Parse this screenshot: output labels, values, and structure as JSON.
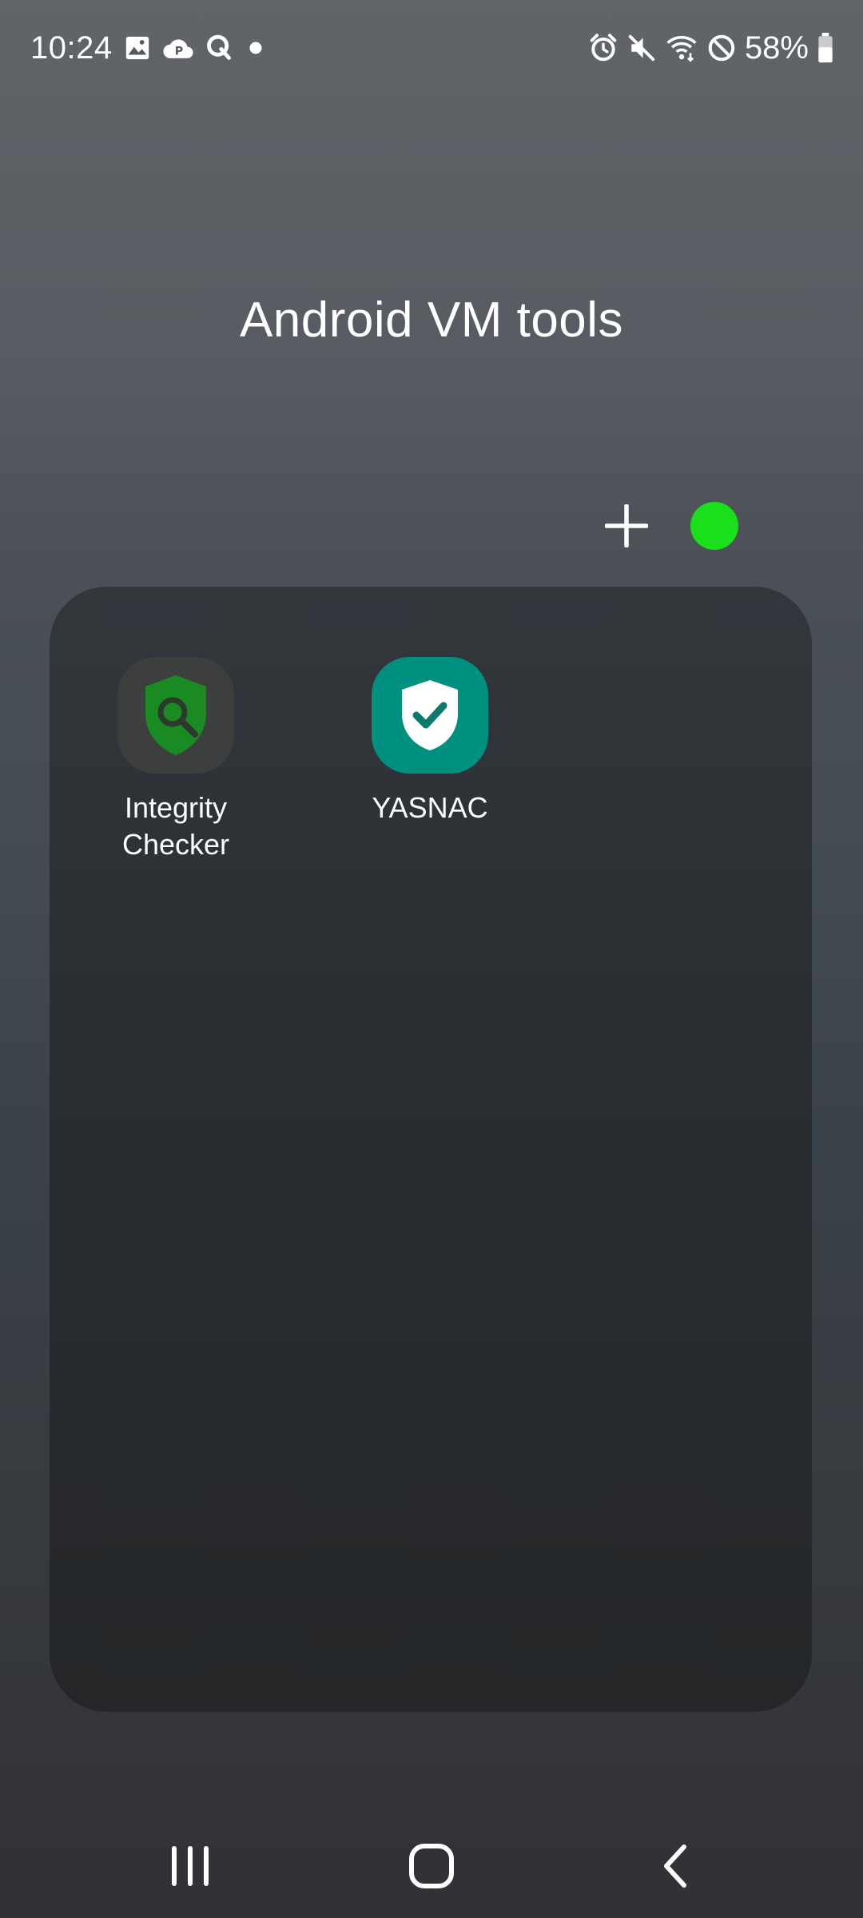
{
  "status_bar": {
    "time": "10:24",
    "battery": "58%",
    "left_icons": [
      "gallery-icon",
      "cloud-p-icon",
      "q-app-icon",
      "dot-icon"
    ],
    "right_icons": [
      "alarm-icon",
      "mute-icon",
      "wifi-icon",
      "do-not-disturb-icon",
      "battery-icon"
    ]
  },
  "folder": {
    "title": "Android VM tools",
    "color": "#19e01a",
    "apps": [
      {
        "label": "Integrity Checker",
        "icon": "shield-search-icon",
        "color": "#1a8a22"
      },
      {
        "label": "YASNAC",
        "icon": "shield-check-icon",
        "color": "#009080"
      }
    ]
  },
  "nav_bar": {
    "buttons": [
      "recent-apps-button",
      "home-button",
      "back-button"
    ]
  }
}
